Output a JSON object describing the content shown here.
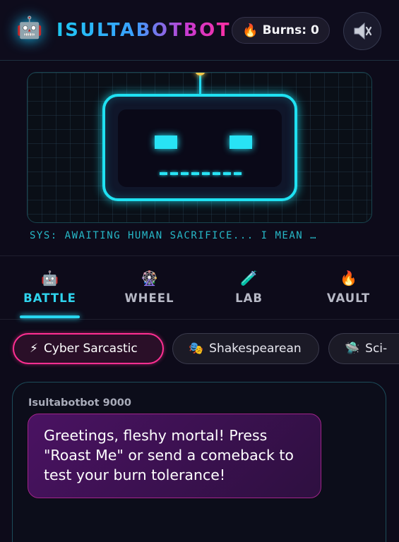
{
  "header": {
    "logo_icon": "robot-face-emoji",
    "title": "ISULTABOTBOT",
    "burns_label": "Burns: 0",
    "burns_icon": "fire-emoji",
    "sound_icon": "speaker-muted-icon"
  },
  "screen": {
    "status_text": "SYS: AWAITING HUMAN SACRIFICE... I MEAN …",
    "accent_color": "#1fe1f2"
  },
  "tabs": [
    {
      "label": "BATTLE",
      "icon": "🤖",
      "active": true
    },
    {
      "label": "WHEEL",
      "icon": "🎡",
      "active": false
    },
    {
      "label": "LAB",
      "icon": "🧪",
      "active": false
    },
    {
      "label": "VAULT",
      "icon": "🔥",
      "active": false
    }
  ],
  "personas": [
    {
      "icon": "⚡",
      "label": "Cyber Sarcastic",
      "active": true
    },
    {
      "icon": "🎭",
      "label": "Shakespearean",
      "active": false
    },
    {
      "icon": "🛸",
      "label": "Sci-",
      "active": false
    }
  ],
  "chat": {
    "sender": "Isultabotbot 9000",
    "message": "Greetings, fleshy mortal! Press \"Roast Me\" or send a comeback to test your burn tolerance!"
  },
  "colors": {
    "cyan": "#28d6ef",
    "pink": "#ff2f92",
    "bubble": "#4a1262"
  }
}
